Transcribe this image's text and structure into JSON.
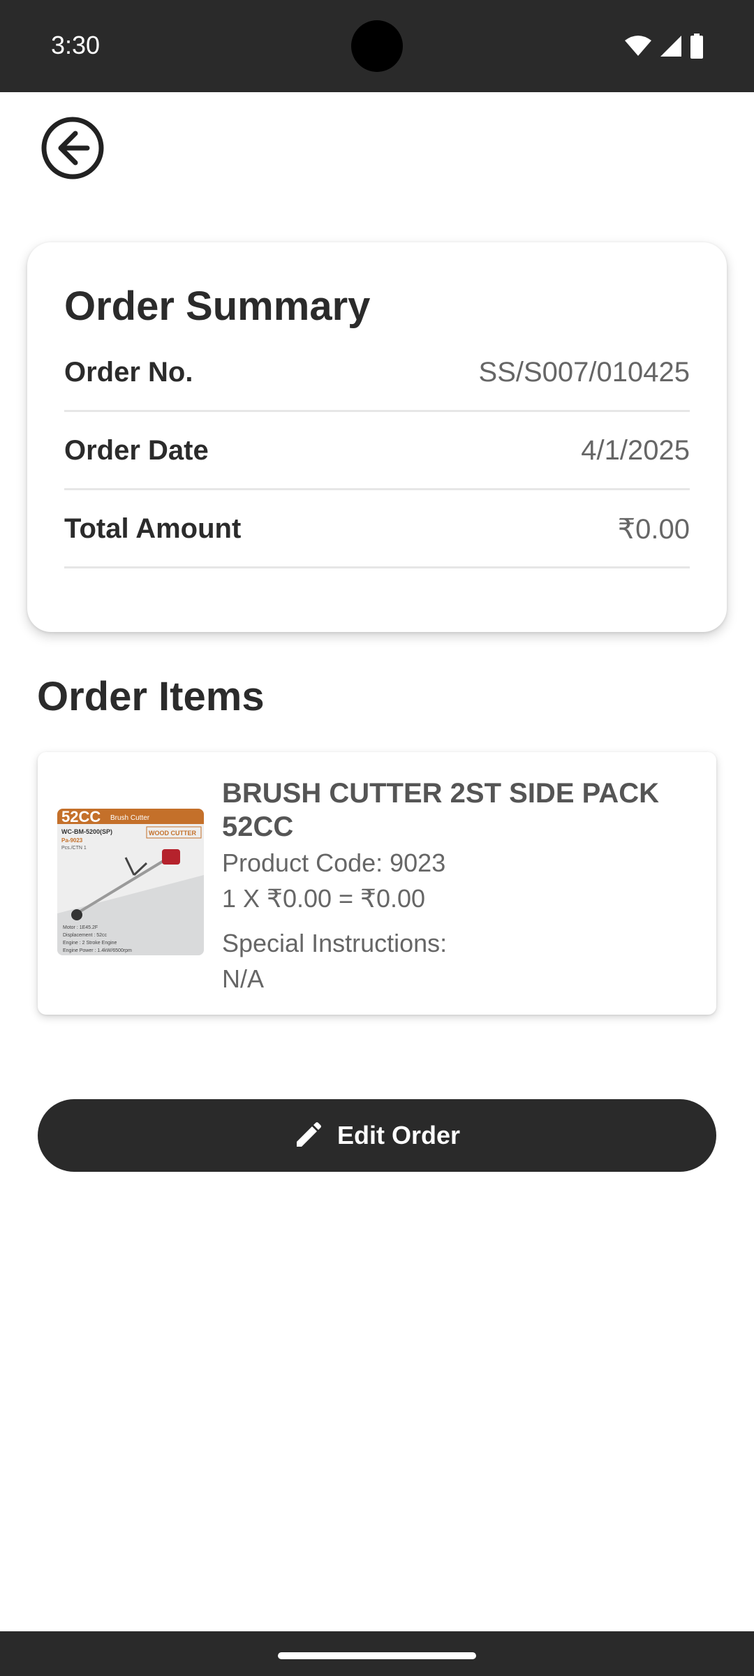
{
  "status_bar": {
    "time": "3:30"
  },
  "summary": {
    "title": "Order Summary",
    "rows": [
      {
        "label": "Order No.",
        "value": "SS/S007/010425"
      },
      {
        "label": "Order Date",
        "value": "4/1/2025"
      },
      {
        "label": "Total Amount",
        "value": "₹0.00"
      }
    ]
  },
  "items_section": {
    "title": "Order Items"
  },
  "items": [
    {
      "name": "BRUSH CUTTER 2ST SIDE PACK 52CC",
      "product_code": "Product Code: 9023",
      "price_line": "1 X ₹0.00 = ₹0.00",
      "instructions_label": "Special Instructions:",
      "instructions_value": "N/A",
      "image": {
        "badge": "52CC",
        "category": "Brush Cutter",
        "model": "WC-BM-5200(SP)",
        "code": "Pa-9023",
        "pcs": "Pcs./CTN 1",
        "brand": "WOOD CUTTER",
        "specs": [
          "Motor : 1E45.2F",
          "Displacement : 52cc",
          "Engine : 2 Stroke Engine",
          "Engine Power : 1.4kW/6500rpm"
        ]
      }
    }
  ],
  "actions": {
    "edit_label": "Edit Order"
  },
  "icons": {
    "back": "arrow-left-circle-icon",
    "edit": "pencil-icon"
  },
  "colors": {
    "primary": "#2a2a2a",
    "accent": "#c4702a"
  }
}
